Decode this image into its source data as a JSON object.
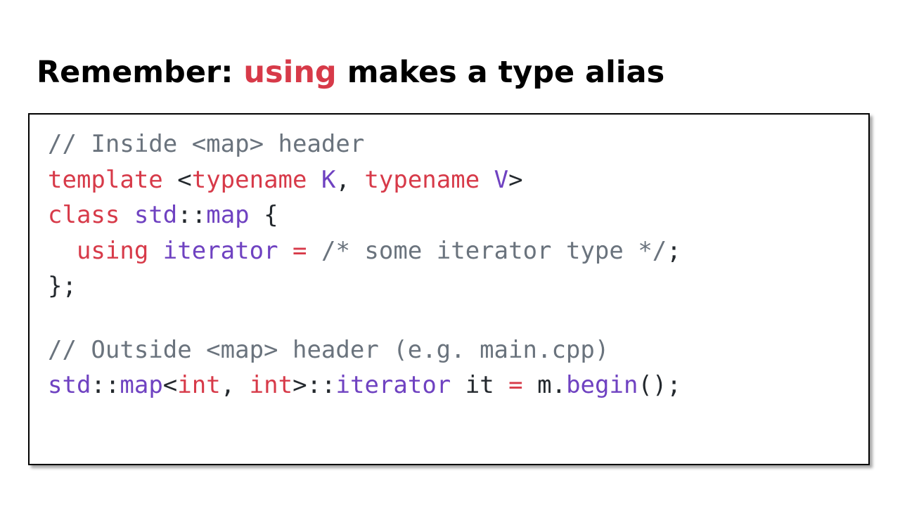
{
  "slide": {
    "title_prefix": "Remember: ",
    "title_keyword": "using",
    "title_suffix": " makes a type alias"
  },
  "code": {
    "lines": [
      [
        {
          "t": "// Inside <map> header",
          "c": "comment"
        }
      ],
      [
        {
          "t": "template",
          "c": "kw"
        },
        {
          "t": " <",
          "c": "plain"
        },
        {
          "t": "typename",
          "c": "kw"
        },
        {
          "t": " ",
          "c": "plain"
        },
        {
          "t": "K",
          "c": "type"
        },
        {
          "t": ", ",
          "c": "plain"
        },
        {
          "t": "typename",
          "c": "kw"
        },
        {
          "t": " ",
          "c": "plain"
        },
        {
          "t": "V",
          "c": "type"
        },
        {
          "t": ">",
          "c": "plain"
        }
      ],
      [
        {
          "t": "class",
          "c": "kw"
        },
        {
          "t": " ",
          "c": "plain"
        },
        {
          "t": "std",
          "c": "type"
        },
        {
          "t": "::",
          "c": "plain"
        },
        {
          "t": "map",
          "c": "type"
        },
        {
          "t": " {",
          "c": "plain"
        }
      ],
      [
        {
          "t": "  ",
          "c": "plain"
        },
        {
          "t": "using",
          "c": "kw"
        },
        {
          "t": " ",
          "c": "plain"
        },
        {
          "t": "iterator",
          "c": "type"
        },
        {
          "t": " ",
          "c": "plain"
        },
        {
          "t": "=",
          "c": "kw"
        },
        {
          "t": " /* some iterator type */",
          "c": "comment"
        },
        {
          "t": ";",
          "c": "plain"
        }
      ],
      [
        {
          "t": "};",
          "c": "plain"
        }
      ],
      [],
      [
        {
          "t": "// Outside <map> header (e.g. main.cpp)",
          "c": "comment"
        }
      ],
      [
        {
          "t": "std",
          "c": "type"
        },
        {
          "t": "::",
          "c": "plain"
        },
        {
          "t": "map",
          "c": "type"
        },
        {
          "t": "<",
          "c": "plain"
        },
        {
          "t": "int",
          "c": "kw"
        },
        {
          "t": ", ",
          "c": "plain"
        },
        {
          "t": "int",
          "c": "kw"
        },
        {
          "t": ">::",
          "c": "plain"
        },
        {
          "t": "iterator",
          "c": "type"
        },
        {
          "t": " it ",
          "c": "plain"
        },
        {
          "t": "=",
          "c": "kw"
        },
        {
          "t": " m.",
          "c": "plain"
        },
        {
          "t": "begin",
          "c": "type"
        },
        {
          "t": "();",
          "c": "plain"
        }
      ]
    ]
  },
  "colors": {
    "keyword": "#d73a49",
    "type": "#6f42c1",
    "comment": "#6a737d",
    "plain": "#24292e"
  }
}
